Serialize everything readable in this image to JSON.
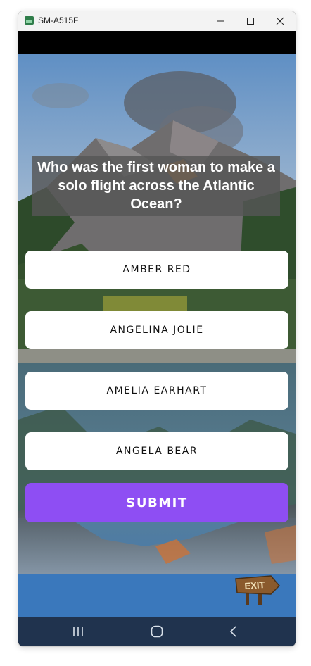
{
  "window": {
    "title": "SM-A515F",
    "controls": {
      "minimize": "minimize-icon",
      "maximize": "maximize-icon",
      "close": "close-icon"
    }
  },
  "quiz": {
    "question": "Who was the first woman to make a solo flight across the Atlantic Ocean?",
    "options": [
      "AMBER RED",
      "ANGELINA JOLIE",
      "AMELIA EARHART",
      "ANGELA BEAR"
    ],
    "submit_label": "SUBMIT",
    "exit_label": "EXIT"
  },
  "navbar": {
    "recents": "recent-apps-icon",
    "home": "home-icon",
    "back": "back-icon"
  },
  "colors": {
    "submit": "#8e4ef3",
    "question_box": "#555555",
    "option_bg": "#ffffff"
  }
}
